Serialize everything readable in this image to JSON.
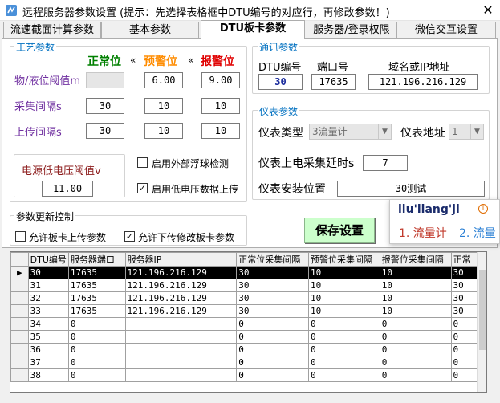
{
  "window": {
    "title": "远程服务器参数设置  (提示：先选择表格框中DTU编号的对应行，再修改参数！)",
    "close": "✕"
  },
  "tabs": [
    "流速截面计算参数",
    "基本参数",
    "DTU板卡参数",
    "服务器/登录权限",
    "微信交互设置"
  ],
  "process": {
    "group_label": "工艺参数",
    "col_normal": "正常位",
    "col_warn": "预警位",
    "col_alarm": "报警位",
    "arrow": "«",
    "rows": [
      {
        "label": "物/液位阈值m",
        "normal": "",
        "warn": "6.00",
        "alarm": "9.00"
      },
      {
        "label": "采集间隔s",
        "normal": "30",
        "warn": "10",
        "alarm": "10"
      },
      {
        "label": "上传间隔s",
        "normal": "30",
        "warn": "10",
        "alarm": "10"
      }
    ],
    "low_voltage_label": "电源低电压阈值v",
    "low_voltage_value": "11.00",
    "ext_float_label": "启用外部浮球检测",
    "ext_float_checked": false,
    "low_voltage_upload_label": "启用低电压数据上传",
    "low_voltage_upload_checked": true
  },
  "comm": {
    "group_label": "通讯参数",
    "dtu_label": "DTU编号",
    "port_label": "端口号",
    "domain_label": "域名或IP地址",
    "dtu_value": "30",
    "port_value": "17635",
    "ip_value": "121.196.216.129"
  },
  "meter": {
    "group_label": "仪表参数",
    "type_label": "仪表类型",
    "type_value": "3流量计",
    "addr_label": "仪表地址",
    "addr_value": "1",
    "delay_label": "仪表上电采集延时s",
    "delay_value": "7",
    "install_label": "仪表安装位置",
    "install_value": "30测试"
  },
  "update": {
    "group_label": "参数更新控制",
    "allow_upload_label": "允许板卡上传参数",
    "allow_upload_checked": false,
    "allow_download_label": "允许下传修改板卡参数",
    "allow_download_checked": true
  },
  "save_label": "保存设置",
  "ime": {
    "pinyin": "liu'liang'ji",
    "info": "i",
    "cand1": "1. 流量计",
    "cand2": "2. 流量"
  },
  "table": {
    "headers": [
      "DTU编号",
      "服务器端口",
      "服务器IP",
      "正常位采集间隔",
      "预警位采集间隔",
      "报警位采集间隔",
      "正常"
    ],
    "rows": [
      [
        "30",
        "17635",
        "121.196.216.129",
        "30",
        "10",
        "10",
        "30"
      ],
      [
        "31",
        "17635",
        "121.196.216.129",
        "30",
        "10",
        "10",
        "30"
      ],
      [
        "32",
        "17635",
        "121.196.216.129",
        "30",
        "10",
        "10",
        "30"
      ],
      [
        "33",
        "17635",
        "121.196.216.129",
        "30",
        "10",
        "10",
        "30"
      ],
      [
        "34",
        "0",
        "",
        "0",
        "0",
        "0",
        "0"
      ],
      [
        "35",
        "0",
        "",
        "0",
        "0",
        "0",
        "0"
      ],
      [
        "36",
        "0",
        "",
        "0",
        "0",
        "0",
        "0"
      ],
      [
        "37",
        "0",
        "",
        "0",
        "0",
        "0",
        "0"
      ],
      [
        "38",
        "0",
        "",
        "0",
        "0",
        "0",
        "0"
      ]
    ],
    "selected_row": 0,
    "row_marker": "▶"
  },
  "colors": {
    "accent_blue": "#0070c0",
    "normal_green": "#008000",
    "warn_orange": "#ff8c00",
    "alarm_red": "#e00000",
    "label_purple": "#7030a0",
    "save_bg": "#ccffcc"
  }
}
